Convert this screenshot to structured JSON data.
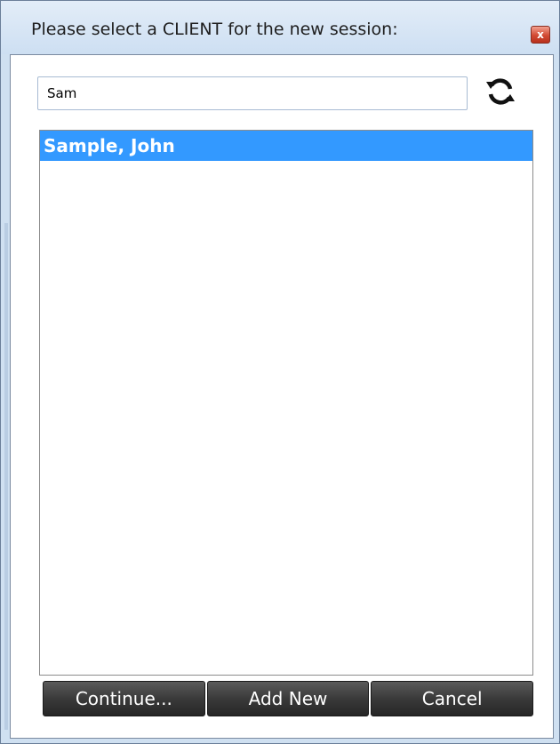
{
  "dialog": {
    "title": "Please select a CLIENT for the new session:",
    "close_label": "x"
  },
  "search": {
    "value": "Sam",
    "refresh_icon": "refresh-icon"
  },
  "client_list": {
    "items": [
      {
        "name": "Sample, John",
        "selected": true
      }
    ]
  },
  "buttons": {
    "continue_label": "Continue...",
    "add_new_label": "Add New",
    "cancel_label": "Cancel"
  },
  "colors": {
    "selection": "#3399ff",
    "button_bg": "#3a3a3a",
    "close_button": "#d24a33"
  }
}
